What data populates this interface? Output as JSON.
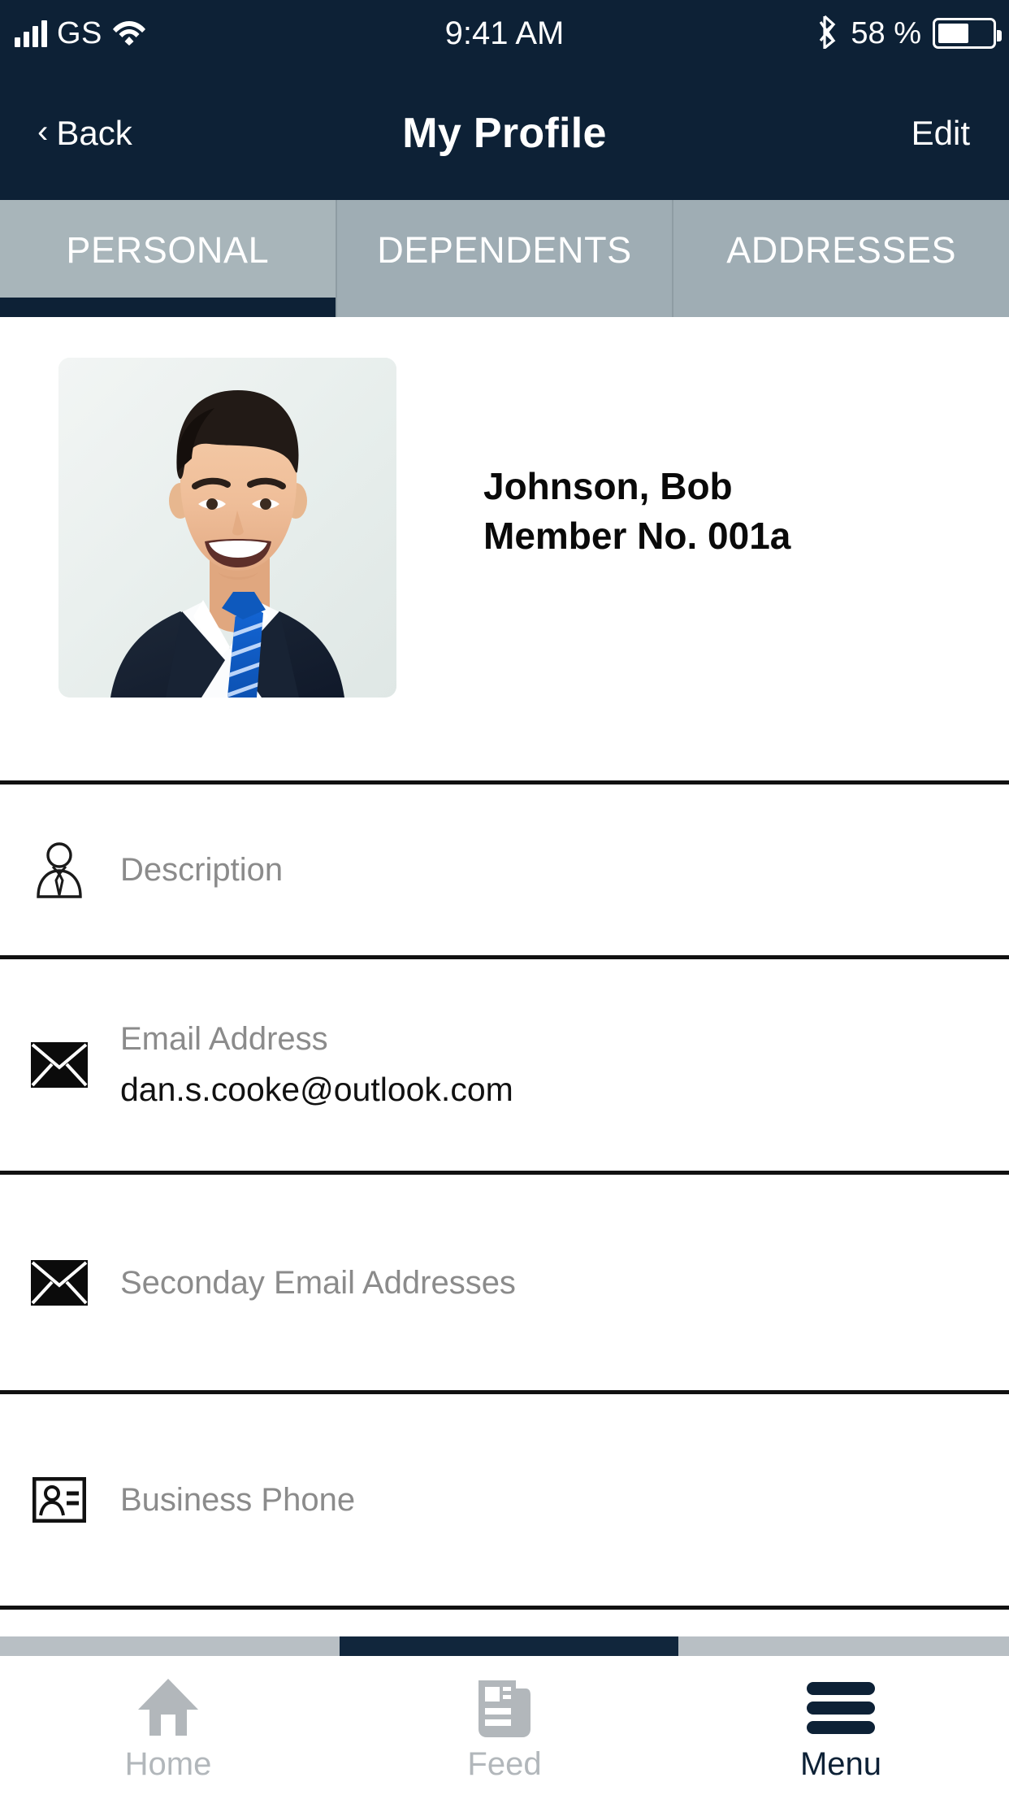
{
  "status_bar": {
    "carrier": "GS",
    "time": "9:41 AM",
    "battery_percent": "58 %",
    "battery_level": 58,
    "icons": [
      "signal-bars-icon",
      "wifi-icon",
      "bluetooth-icon",
      "battery-icon"
    ]
  },
  "nav_bar": {
    "back_label": "Back",
    "back_chevron": "‹",
    "title": "My Profile",
    "edit_label": "Edit"
  },
  "tabs": {
    "active_index": 0,
    "items": [
      {
        "label": "PERSONAL"
      },
      {
        "label": "DEPENDENTS"
      },
      {
        "label": "ADDRESSES"
      }
    ]
  },
  "profile": {
    "avatar_alt": "profile-photo",
    "name": "Johnson, Bob",
    "member_no": "Member No. 001a"
  },
  "fields": [
    {
      "icon": "person-tie-icon",
      "label": "Description",
      "value": ""
    },
    {
      "icon": "envelope-icon",
      "label": "Email Address",
      "value": "dan.s.cooke@outlook.com"
    },
    {
      "icon": "envelope-icon",
      "label": "Seconday Email Addresses",
      "value": ""
    },
    {
      "icon": "contact-card-icon",
      "label": "Business Phone",
      "value": ""
    }
  ],
  "bottom_nav": {
    "active_index": 2,
    "items": [
      {
        "label": "Home",
        "icon": "home-icon"
      },
      {
        "label": "Feed",
        "icon": "newspaper-icon"
      },
      {
        "label": "Menu",
        "icon": "hamburger-icon"
      }
    ]
  },
  "colors": {
    "header_navy": "#0d2136",
    "tab_gray": "#9fadb4",
    "tab_active_gray": "#a8b5ba",
    "label_gray": "#8b8b8b",
    "inactive_icon_gray": "#b2b7bb"
  }
}
